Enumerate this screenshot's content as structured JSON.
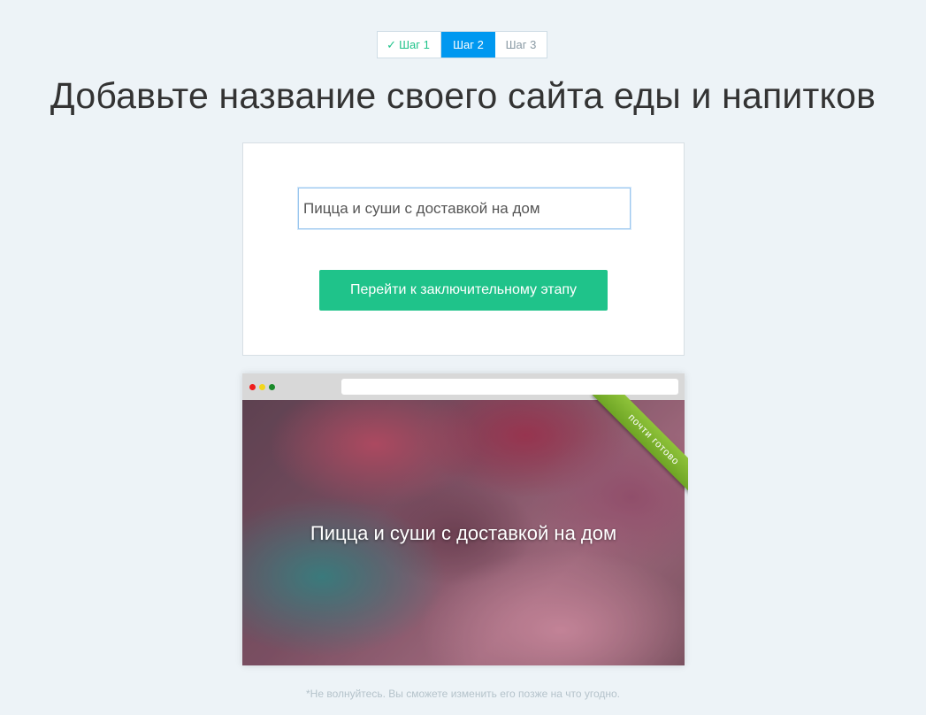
{
  "steps": {
    "step1": "Шаг 1",
    "step2": "Шаг 2",
    "step3": "Шаг 3",
    "completed_icon": "checkmark-icon"
  },
  "heading": "Добавьте название своего сайта еды и напитков",
  "form": {
    "site_name_value": "Пицца и суши с доставкой на дом",
    "next_button_label": "Перейти к заключительному этапу"
  },
  "preview": {
    "window_dots": [
      "#ef1c1c",
      "#f2d61b",
      "#1a8a2a"
    ],
    "site_title": "Пицца и суши с доставкой на дом",
    "ribbon_label": "почти готово"
  },
  "footnote": "*Не волнуйтесь. Вы сможете изменить его позже на что угодно.",
  "colors": {
    "accent_blue": "#0098f0",
    "accent_green": "#1fc38a",
    "background": "#edf3f7"
  }
}
